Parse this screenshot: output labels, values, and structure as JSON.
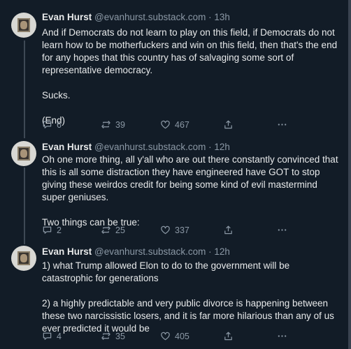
{
  "posts": [
    {
      "name": "Evan Hurst",
      "handle": "@evanhurst.substack.com",
      "time": "13h",
      "paragraphs": [
        "And if Democrats do not learn to play on this field, if Democrats do not learn how to be motherfuckers and win on this field, then that's the end for any hopes that this country has of salvaging some sort of representative democracy.",
        "Sucks.",
        "(End)"
      ],
      "replies": "6",
      "reposts": "39",
      "likes": "467"
    },
    {
      "name": "Evan Hurst",
      "handle": "@evanhurst.substack.com",
      "time": "12h",
      "paragraphs": [
        "Oh one more thing, all y'all who are out there constantly convinced that this is all some distraction they have engineered have GOT to stop giving these weirdos credit for being some kind of evil mastermind super geniuses.",
        "Two things can be true:"
      ],
      "replies": "2",
      "reposts": "25",
      "likes": "337"
    },
    {
      "name": "Evan Hurst",
      "handle": "@evanhurst.substack.com",
      "time": "12h",
      "paragraphs": [
        "1) what Trump allowed Elon to do to the government will be catastrophic for generations",
        "2) a highly predictable and very public divorce is happening between these two narcissistic losers, and it is far more hilarious than any of us ever predicted it would be"
      ],
      "replies": "4",
      "reposts": "35",
      "likes": "405"
    }
  ],
  "separator": "·",
  "icons": [
    "reply-icon",
    "repost-icon",
    "like-icon",
    "share-icon",
    "more-icon"
  ],
  "colors": {
    "background": "#121c27",
    "text": "#e7e9ea",
    "muted": "#8b98a5",
    "thread_line": "#3e4955"
  }
}
